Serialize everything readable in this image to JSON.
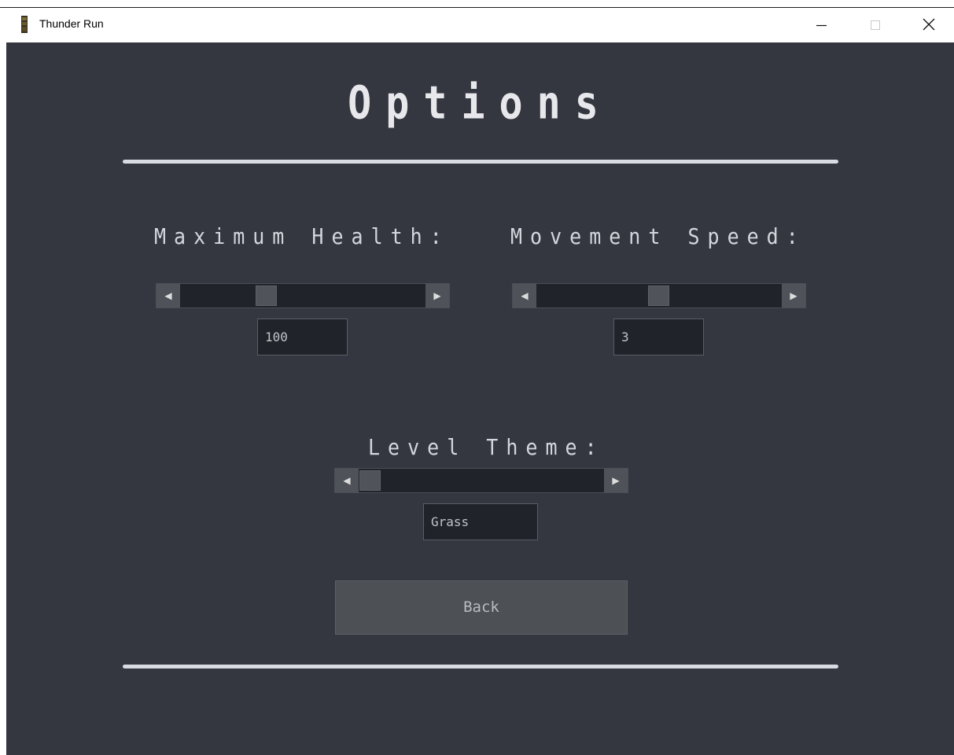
{
  "window": {
    "title": "Thunder Run",
    "icon": "tower-icon",
    "controls": {
      "minimize_icon": "minimize-icon",
      "maximize_icon": "maximize-icon",
      "close_icon": "close-icon"
    }
  },
  "options": {
    "heading": "Options",
    "max_health": {
      "label": "Maximum Health:",
      "value": "100",
      "slider_fraction": 0.35
    },
    "movement_speed": {
      "label": "Movement Speed:",
      "value": "3",
      "slider_fraction": 0.5
    },
    "level_theme": {
      "label": "Level Theme:",
      "value": "Grass",
      "slider_fraction": 0.0
    },
    "back_button": "Back"
  },
  "colors": {
    "background": "#343740",
    "heading": "#e8e8ec",
    "rule": "#d9dbe2",
    "field_bg": "#20242a",
    "button_bg": "#4d5054"
  }
}
